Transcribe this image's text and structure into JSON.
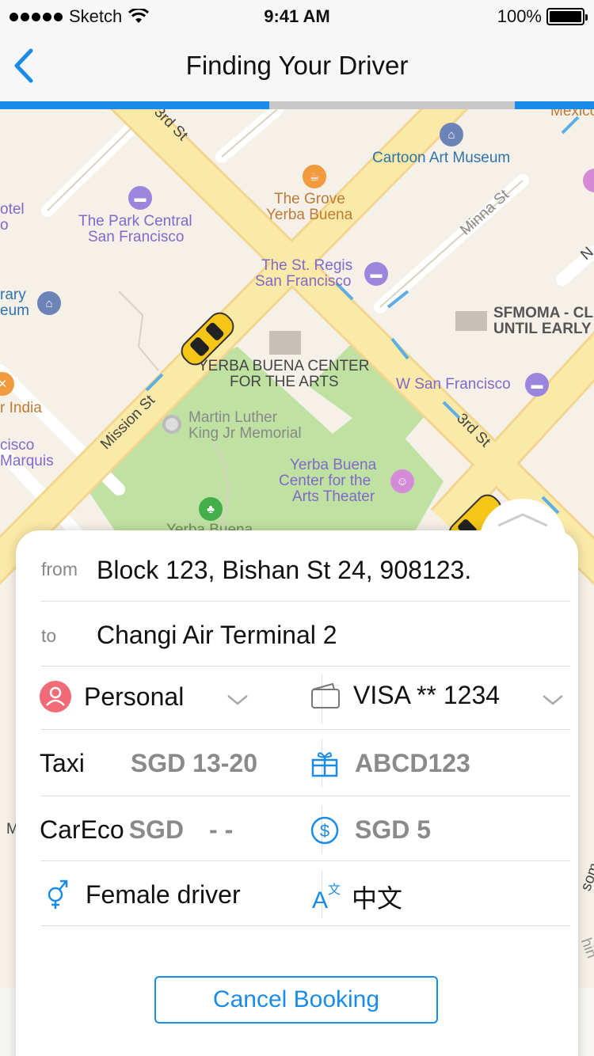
{
  "status_bar": {
    "carrier": "Sketch",
    "time": "9:41 AM",
    "battery": "100%"
  },
  "nav": {
    "title": "Finding Your Driver"
  },
  "progress": {
    "segments_filled": 2,
    "segments_total": 3
  },
  "map": {
    "places": {
      "cartoon_art_museum": "Cartoon Art Museum",
      "the_grove_1": "The Grove",
      "the_grove_2": "Yerba Buena",
      "park_central_1": "The Park Central",
      "park_central_2": "San Francisco",
      "st_regis_1": "The St. Regis",
      "st_regis_2": "San Francisco",
      "hotel_partial_1": "otel",
      "hotel_partial_2": "o",
      "library_partial_1": "rary",
      "library_partial_2": "eum",
      "sfmoma_1": "SFMOMA - CL",
      "sfmoma_2": "UNTIL EARLY",
      "ybca_1": "YERBA BUENA CENTER",
      "ybca_2": "FOR THE ARTS",
      "w_sf": "W San Francisco",
      "india_partial": "r India",
      "mlk_1": "Martin Luther",
      "mlk_2": "King Jr Memorial",
      "marquis_1": "cisco",
      "marquis_2": "Marquis",
      "yb_theater_1": "Yerba Buena",
      "yb_theater_2": "Center for the",
      "yb_theater_3": "Arts Theater",
      "mexico_partial": "Mexico",
      "yb_gardens_partial": "Yerba Buena",
      "left_m": "M",
      "right_som": "som",
      "right_hin": "hin"
    },
    "streets": {
      "third_st_top": "3rd St",
      "minna_st": "Minna St",
      "mission_st": "Mission St",
      "third_st": "3rd St",
      "n_partial": "N"
    }
  },
  "booking": {
    "from_label": "from",
    "from_value": "Block 123, Bishan St 24, 908123.",
    "to_label": "to",
    "to_value": "Changi Air Terminal 2",
    "profile": "Personal",
    "payment": "VISA ** 1234",
    "taxi_label": "Taxi",
    "taxi_fare": "SGD 13-20",
    "promo_code": "ABCD123",
    "careco_label": "CarEco",
    "careco_currency": "SGD",
    "careco_fare": "- -",
    "tip": "SGD 5",
    "female_driver": "Female driver",
    "language": "中文",
    "cancel_label": "Cancel Booking"
  },
  "colors": {
    "accent": "#1a8ce8",
    "profile_red": "#f06a78",
    "road_yellow": "#fbe8a3",
    "park_green": "#b9df9b"
  },
  "icons": {
    "back": "chevron-left-icon",
    "profile": "person-icon",
    "wallet": "wallet-icon",
    "gift": "gift-icon",
    "dollar": "dollar-icon",
    "gender": "gender-icon",
    "translate": "translate-icon",
    "chevron_down": "chevron-down-icon",
    "collapse": "chevron-up-icon"
  }
}
